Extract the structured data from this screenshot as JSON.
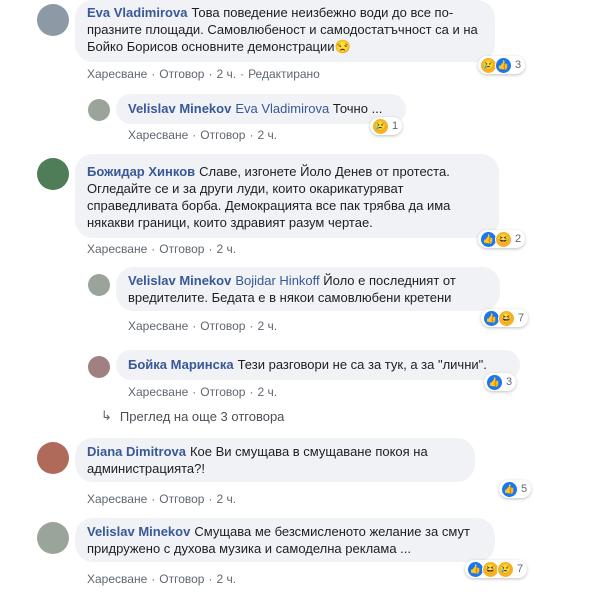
{
  "comments": [
    {
      "author": "Eva Vladimirova",
      "text": "Това поведение неизбежно води до все по-празните площади. Самовлюбеност и самодостатъчност са и на Бойко Борисов основните демонстрации😒",
      "like": "Харесване",
      "reply": "Отговор",
      "time": "2 ч.",
      "edited": "Редактирано",
      "reaction_count": "3"
    },
    {
      "author": "Velislav Minekov",
      "mention": "Eva Vladimirova",
      "text": "Точно ...",
      "like": "Харесване",
      "reply": "Отговор",
      "time": "2 ч.",
      "reaction_count": "1"
    },
    {
      "author": "Божидар Хинков",
      "text": "Славе, изгонете Йоло Денев от протеста. Огледайте се и за други луди, които окарикатуряват справедливата борба. Демокрацията все пак трябва да има някакви граници, които здравият разум чертае.",
      "like": "Харесване",
      "reply": "Отговор",
      "time": "2 ч.",
      "reaction_count": "2"
    },
    {
      "author": "Velislav Minekov",
      "mention": "Bojidar Hinkoff",
      "text": "Йоло е последният от вредителите. Бедата е в някои самовлюбени кретени",
      "like": "Харесване",
      "reply": "Отговор",
      "time": "2 ч.",
      "reaction_count": "7"
    },
    {
      "author": "Бойка Маринска",
      "text": "Тези разговори не са за тук, а за \"лични\".",
      "like": "Харесване",
      "reply": "Отговор",
      "time": "2 ч.",
      "reaction_count": "3"
    },
    {
      "author": "Diana Dimitrova",
      "text": "Кое Ви смущава в смущаване покоя на администрацията?!",
      "like": "Харесване",
      "reply": "Отговор",
      "time": "2 ч.",
      "reaction_count": "5"
    },
    {
      "author": "Velislav Minekov",
      "text": "Смущава ме безсмисленото желание за смут придружено с духова музика и самоделна реклама ...",
      "like": "Харесване",
      "reply": "Отговор",
      "time": "2 ч.",
      "reaction_count": "7"
    }
  ],
  "more_replies": "Преглед на още 3 отговора",
  "icons": {
    "like": "thumbs-up-icon",
    "haha": "laughing-face-icon",
    "sad": "crying-face-icon",
    "more": "reply-arrow-icon"
  },
  "colors": {
    "link": "#385898",
    "bubble": "#f0f2f5",
    "like": "#1877f2",
    "emoji": "#f7b125"
  }
}
